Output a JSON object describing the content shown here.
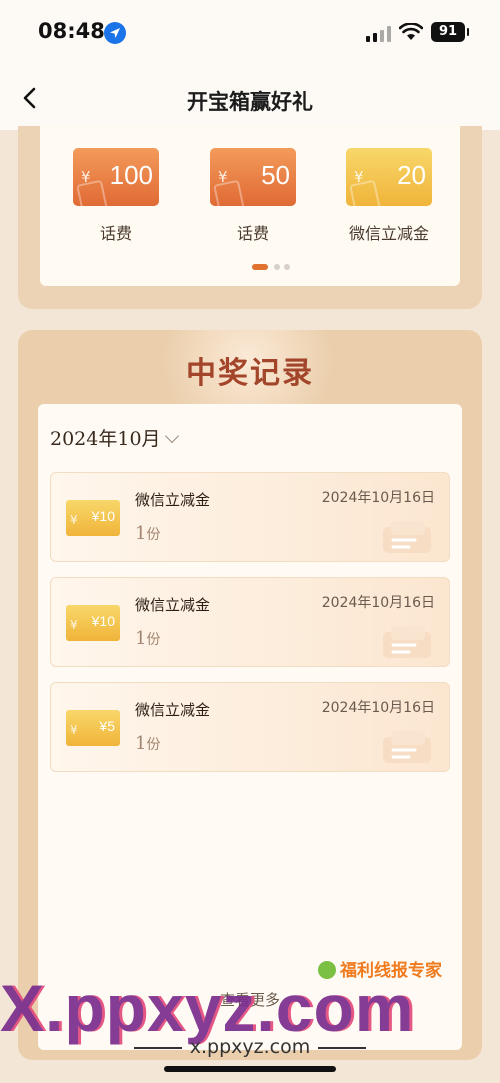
{
  "status_bar": {
    "time": "08:48",
    "battery": "91"
  },
  "nav": {
    "title": "开宝箱赢好礼"
  },
  "prizes": {
    "items": [
      {
        "yen": "¥",
        "amount": "100",
        "name": "话费",
        "color": "#e06a35"
      },
      {
        "yen": "¥",
        "amount": "50",
        "name": "话费",
        "color": "#e06a35"
      },
      {
        "yen": "¥",
        "amount": "20",
        "name": "微信立减金",
        "color": "#f0b43a"
      }
    ],
    "pages": 3,
    "current_page": 1
  },
  "records": {
    "title": "中奖记录",
    "month": "2024年10月",
    "items": [
      {
        "coupon_yen": "¥",
        "coupon_value": "¥10",
        "name": "微信立减金",
        "date": "2024年10月16日",
        "qty_num": "1",
        "qty_unit": "份"
      },
      {
        "coupon_yen": "¥",
        "coupon_value": "¥10",
        "name": "微信立减金",
        "date": "2024年10月16日",
        "qty_num": "1",
        "qty_unit": "份"
      },
      {
        "coupon_yen": "¥",
        "coupon_value": "¥5",
        "name": "微信立减金",
        "date": "2024年10月16日",
        "qty_num": "1",
        "qty_unit": "份"
      }
    ],
    "more_label": "查看更多"
  },
  "watermark": {
    "brand": "福利线报专家",
    "big": "X.ppxyz.com",
    "url": "x.ppxyz.com"
  }
}
